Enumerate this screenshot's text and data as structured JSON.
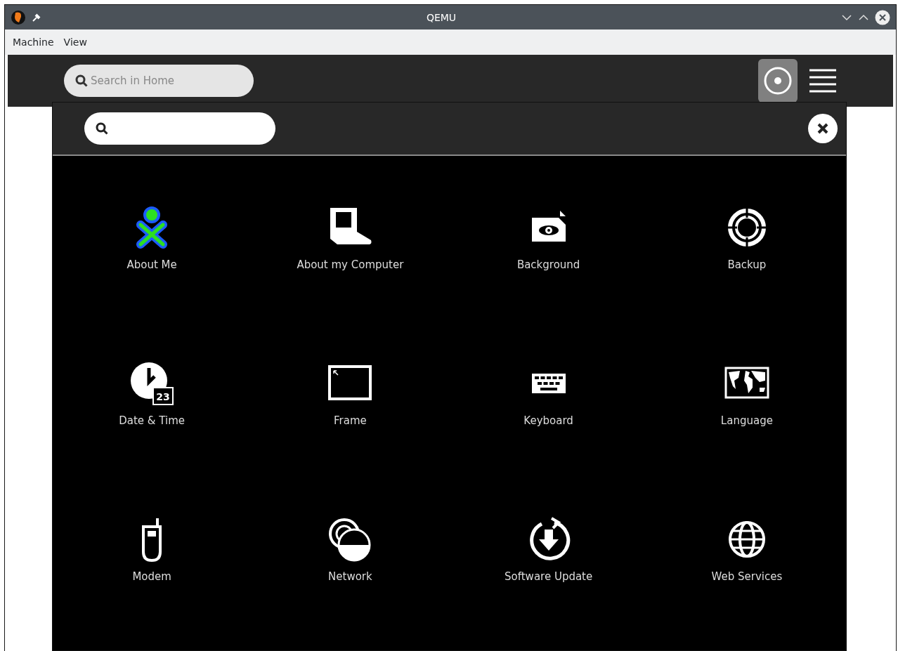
{
  "window": {
    "title": "QEMU"
  },
  "menu": [
    "Machine",
    "View"
  ],
  "toolbar": {
    "search": {
      "placeholder": "Search in Home"
    },
    "views": [
      {
        "kind": "home",
        "selected": true
      },
      {
        "kind": "list",
        "selected": false
      }
    ]
  },
  "control_panel": {
    "items": [
      {
        "kind": "me",
        "label": "About Me"
      },
      {
        "kind": "computer",
        "label": "About my Computer"
      },
      {
        "kind": "background",
        "label": "Background"
      },
      {
        "kind": "backup",
        "label": "Backup"
      },
      {
        "kind": "datetime",
        "label": "Date & Time",
        "icon_text": "23"
      },
      {
        "kind": "frame",
        "label": "Frame"
      },
      {
        "kind": "keyboard",
        "label": "Keyboard"
      },
      {
        "kind": "language",
        "label": "Language"
      },
      {
        "kind": "modem",
        "label": "Modem"
      },
      {
        "kind": "network",
        "label": "Network"
      },
      {
        "kind": "update",
        "label": "Software Update"
      },
      {
        "kind": "web",
        "label": "Web Services"
      }
    ]
  }
}
